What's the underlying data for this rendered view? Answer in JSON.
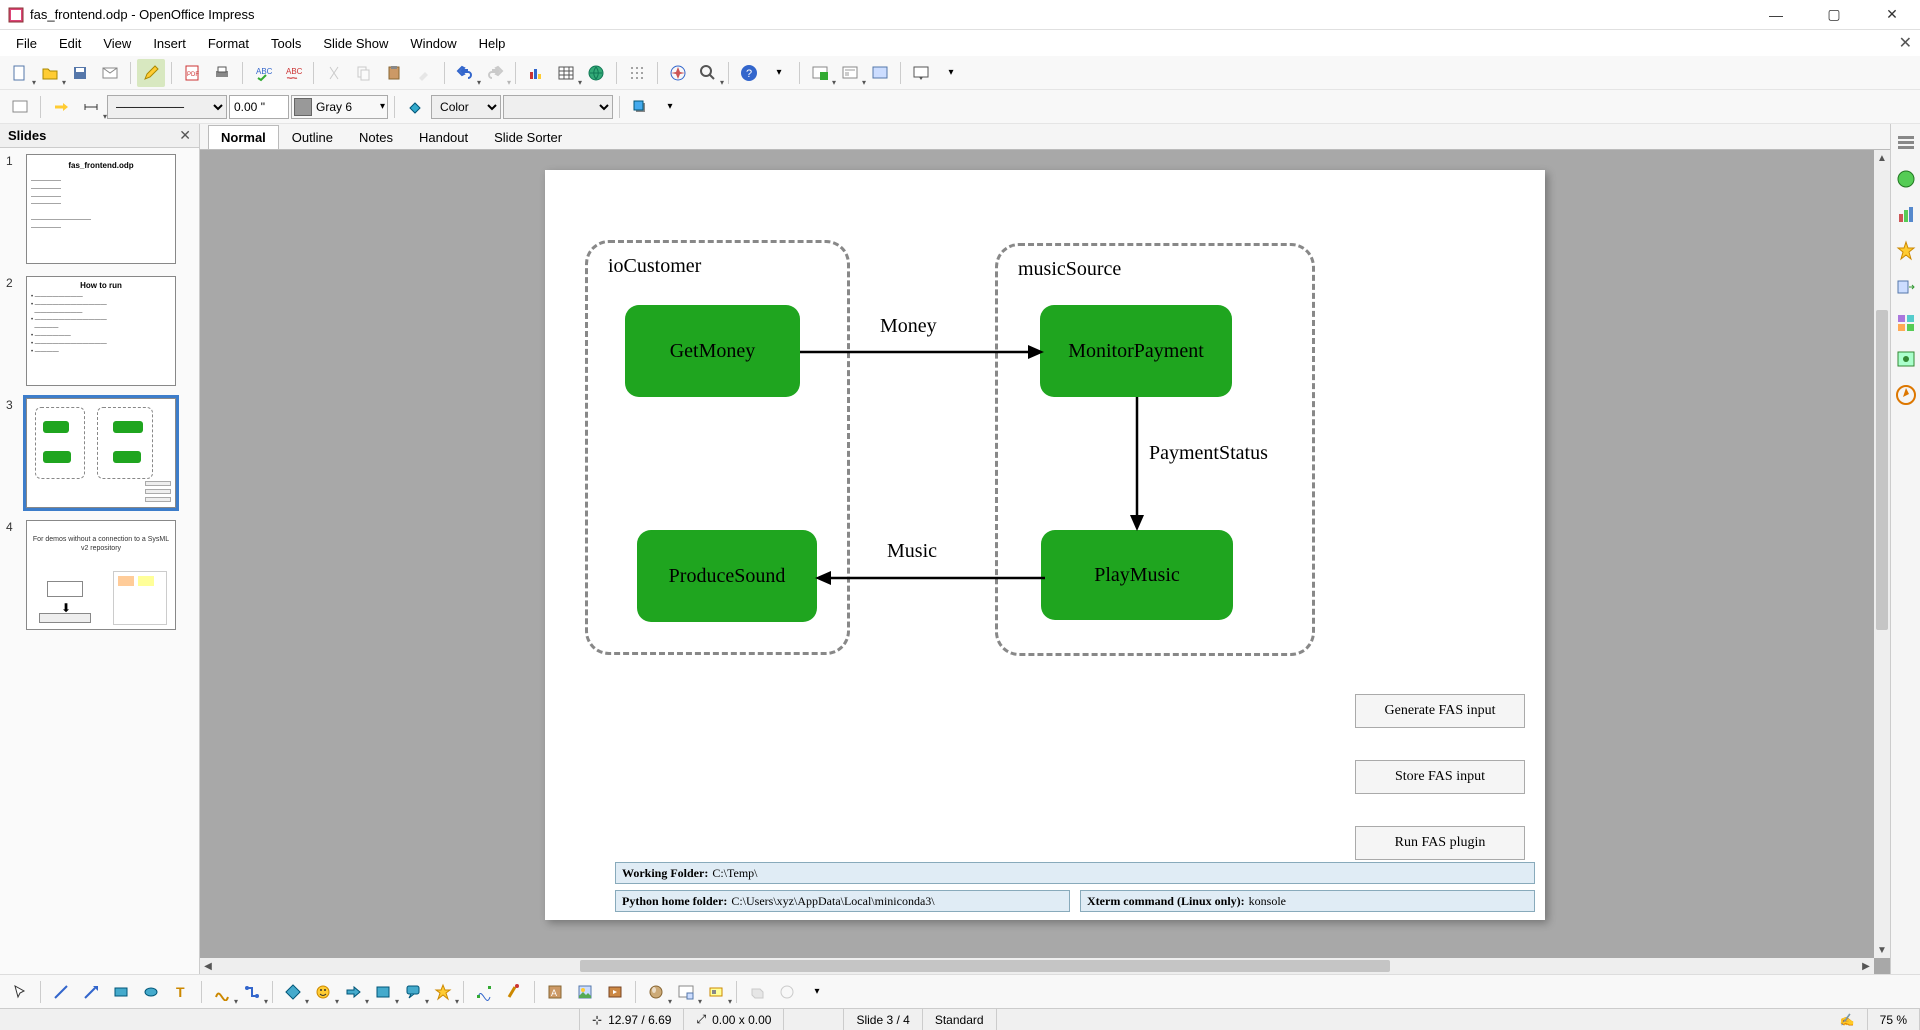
{
  "app": {
    "title": "fas_frontend.odp - OpenOffice Impress"
  },
  "menu": {
    "file": "File",
    "edit": "Edit",
    "view": "View",
    "insert": "Insert",
    "format": "Format",
    "tools": "Tools",
    "slideshow": "Slide Show",
    "window": "Window",
    "help": "Help"
  },
  "toolbar2": {
    "linewidth": "0.00 \"",
    "linecolor_name": "Gray 6",
    "fillmode": "Color",
    "fillcolor": ""
  },
  "slides_panel": {
    "title": "Slides",
    "slides": [
      {
        "num": "1",
        "title": "fas_frontend.odp"
      },
      {
        "num": "2",
        "title": "How to run"
      },
      {
        "num": "3",
        "title": ""
      },
      {
        "num": "4",
        "title": "For demos without a connection to a SysML v2 repository"
      }
    ],
    "selected_index": 2
  },
  "view_tabs": {
    "normal": "Normal",
    "outline": "Outline",
    "notes": "Notes",
    "handout": "Handout",
    "sorter": "Slide Sorter"
  },
  "diagram": {
    "group1_label": "ioCustomer",
    "group2_label": "musicSource",
    "box_getmoney": "GetMoney",
    "box_monitorpayment": "MonitorPayment",
    "box_producesound": "ProduceSound",
    "box_playmusic": "PlayMusic",
    "arrow_money": "Money",
    "arrow_paymentstatus": "PaymentStatus",
    "arrow_music": "Music",
    "btn_generate": "Generate FAS input",
    "btn_store": "Store FAS input",
    "btn_run": "Run FAS plugin",
    "working_folder_label": "Working Folder:",
    "working_folder_value": " C:\\Temp\\",
    "python_home_label": "Python home folder:",
    "python_home_value": " C:\\Users\\xyz\\AppData\\Local\\miniconda3\\",
    "xterm_label": "Xterm command (Linux only):",
    "xterm_value": " konsole"
  },
  "status": {
    "coords": "12.97 / 6.69",
    "size": "0.00 x 0.00",
    "slide": "Slide 3 / 4",
    "mode": "Standard",
    "zoom": "75 %"
  }
}
